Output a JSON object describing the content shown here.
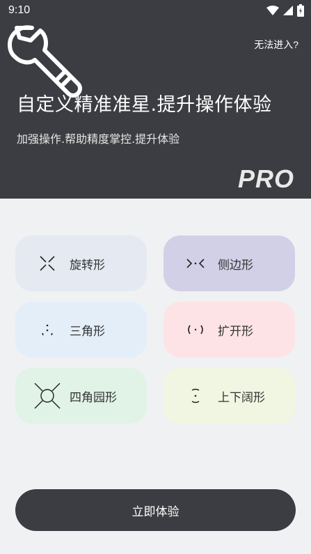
{
  "status_bar": {
    "time": "9:10"
  },
  "header": {
    "help_link": "无法进入?",
    "title": "自定义精准准星.提升操作体验",
    "subtitle": "加强操作.帮助精度掌控.提升体验",
    "badge": "PRO",
    "bg_color": "#3c3d42"
  },
  "modes": [
    {
      "label": "旋转形",
      "icon": "rotate-crosshair-icon",
      "bg": "#e4e9f2"
    },
    {
      "label": "侧边形",
      "icon": "side-crosshair-icon",
      "bg": "#d1d0e6"
    },
    {
      "label": "三角形",
      "icon": "triangle-crosshair-icon",
      "bg": "#e3eef9"
    },
    {
      "label": "扩开形",
      "icon": "expand-crosshair-icon",
      "bg": "#fde3e6"
    },
    {
      "label": "四角园形",
      "icon": "four-corner-circle-icon",
      "bg": "#e1f2e7"
    },
    {
      "label": "上下阔形",
      "icon": "vertical-wide-crosshair-icon",
      "bg": "#f1f6e2"
    }
  ],
  "cta": {
    "label": "立即体验"
  }
}
